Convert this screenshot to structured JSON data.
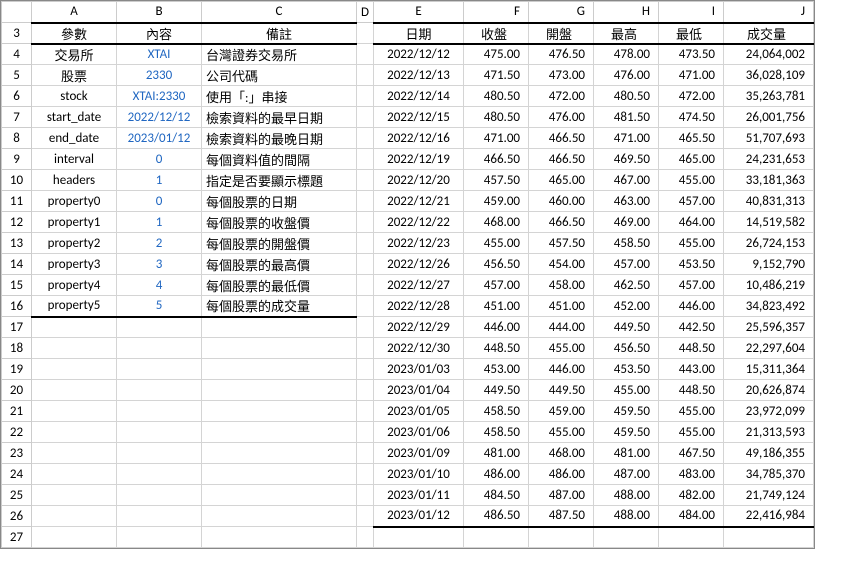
{
  "columns": [
    "A",
    "B",
    "C",
    "D",
    "E",
    "F",
    "G",
    "H",
    "I",
    "J"
  ],
  "rowStart": 3,
  "rowEnd": 27,
  "left": {
    "headers": {
      "A": "參數",
      "B": "內容",
      "C": "備註"
    },
    "rows": [
      {
        "A": "交易所",
        "B": "XTAI",
        "C": "台灣證券交易所"
      },
      {
        "A": "股票",
        "B": "2330",
        "C": "公司代碼"
      },
      {
        "A": "stock",
        "B": "XTAI:2330",
        "C": "使用「:」串接"
      },
      {
        "A": "start_date",
        "B": "2022/12/12",
        "C": "檢索資料的最早日期"
      },
      {
        "A": "end_date",
        "B": "2023/01/12",
        "C": "檢索資料的最晚日期"
      },
      {
        "A": "interval",
        "B": "0",
        "C": "每個資料值的間隔"
      },
      {
        "A": "headers",
        "B": "1",
        "C": "指定是否要顯示標題"
      },
      {
        "A": "property0",
        "B": "0",
        "C": "每個股票的日期"
      },
      {
        "A": "property1",
        "B": "1",
        "C": "每個股票的收盤價"
      },
      {
        "A": "property2",
        "B": "2",
        "C": "每個股票的開盤價"
      },
      {
        "A": "property3",
        "B": "3",
        "C": "每個股票的最高價"
      },
      {
        "A": "property4",
        "B": "4",
        "C": "每個股票的最低價"
      },
      {
        "A": "property5",
        "B": "5",
        "C": "每個股票的成交量"
      }
    ]
  },
  "right": {
    "headers": {
      "E": "日期",
      "F": "收盤",
      "G": "開盤",
      "H": "最高",
      "I": "最低",
      "J": "成交量"
    },
    "rows": [
      {
        "E": "2022/12/12",
        "F": "475.00",
        "G": "476.50",
        "H": "478.00",
        "I": "473.50",
        "J": "24,064,002"
      },
      {
        "E": "2022/12/13",
        "F": "471.50",
        "G": "473.00",
        "H": "476.00",
        "I": "471.00",
        "J": "36,028,109"
      },
      {
        "E": "2022/12/14",
        "F": "480.50",
        "G": "472.00",
        "H": "480.50",
        "I": "472.00",
        "J": "35,263,781"
      },
      {
        "E": "2022/12/15",
        "F": "480.50",
        "G": "476.00",
        "H": "481.50",
        "I": "474.50",
        "J": "26,001,756"
      },
      {
        "E": "2022/12/16",
        "F": "471.00",
        "G": "466.50",
        "H": "471.00",
        "I": "465.50",
        "J": "51,707,693"
      },
      {
        "E": "2022/12/19",
        "F": "466.50",
        "G": "466.50",
        "H": "469.50",
        "I": "465.00",
        "J": "24,231,653"
      },
      {
        "E": "2022/12/20",
        "F": "457.50",
        "G": "465.00",
        "H": "467.00",
        "I": "455.00",
        "J": "33,181,363"
      },
      {
        "E": "2022/12/21",
        "F": "459.00",
        "G": "460.00",
        "H": "463.00",
        "I": "457.00",
        "J": "40,831,313"
      },
      {
        "E": "2022/12/22",
        "F": "468.00",
        "G": "466.50",
        "H": "469.00",
        "I": "464.00",
        "J": "14,519,582"
      },
      {
        "E": "2022/12/23",
        "F": "455.00",
        "G": "457.50",
        "H": "458.50",
        "I": "455.00",
        "J": "26,724,153"
      },
      {
        "E": "2022/12/26",
        "F": "456.50",
        "G": "454.00",
        "H": "457.00",
        "I": "453.50",
        "J": "9,152,790"
      },
      {
        "E": "2022/12/27",
        "F": "457.00",
        "G": "458.00",
        "H": "462.50",
        "I": "457.00",
        "J": "10,486,219"
      },
      {
        "E": "2022/12/28",
        "F": "451.00",
        "G": "451.00",
        "H": "452.00",
        "I": "446.00",
        "J": "34,823,492"
      },
      {
        "E": "2022/12/29",
        "F": "446.00",
        "G": "444.00",
        "H": "449.50",
        "I": "442.50",
        "J": "25,596,357"
      },
      {
        "E": "2022/12/30",
        "F": "448.50",
        "G": "455.00",
        "H": "456.50",
        "I": "448.50",
        "J": "22,297,604"
      },
      {
        "E": "2023/01/03",
        "F": "453.00",
        "G": "446.00",
        "H": "453.50",
        "I": "443.00",
        "J": "15,311,364"
      },
      {
        "E": "2023/01/04",
        "F": "449.50",
        "G": "449.50",
        "H": "455.00",
        "I": "448.50",
        "J": "20,626,874"
      },
      {
        "E": "2023/01/05",
        "F": "458.50",
        "G": "459.00",
        "H": "459.50",
        "I": "455.00",
        "J": "23,972,099"
      },
      {
        "E": "2023/01/06",
        "F": "458.50",
        "G": "455.00",
        "H": "459.50",
        "I": "455.00",
        "J": "21,313,593"
      },
      {
        "E": "2023/01/09",
        "F": "481.00",
        "G": "468.00",
        "H": "481.00",
        "I": "467.50",
        "J": "49,186,355"
      },
      {
        "E": "2023/01/10",
        "F": "486.00",
        "G": "486.00",
        "H": "487.00",
        "I": "483.00",
        "J": "34,785,370"
      },
      {
        "E": "2023/01/11",
        "F": "484.50",
        "G": "487.00",
        "H": "488.00",
        "I": "482.00",
        "J": "21,749,124"
      },
      {
        "E": "2023/01/12",
        "F": "486.50",
        "G": "487.50",
        "H": "488.00",
        "I": "484.00",
        "J": "22,416,984"
      }
    ]
  }
}
